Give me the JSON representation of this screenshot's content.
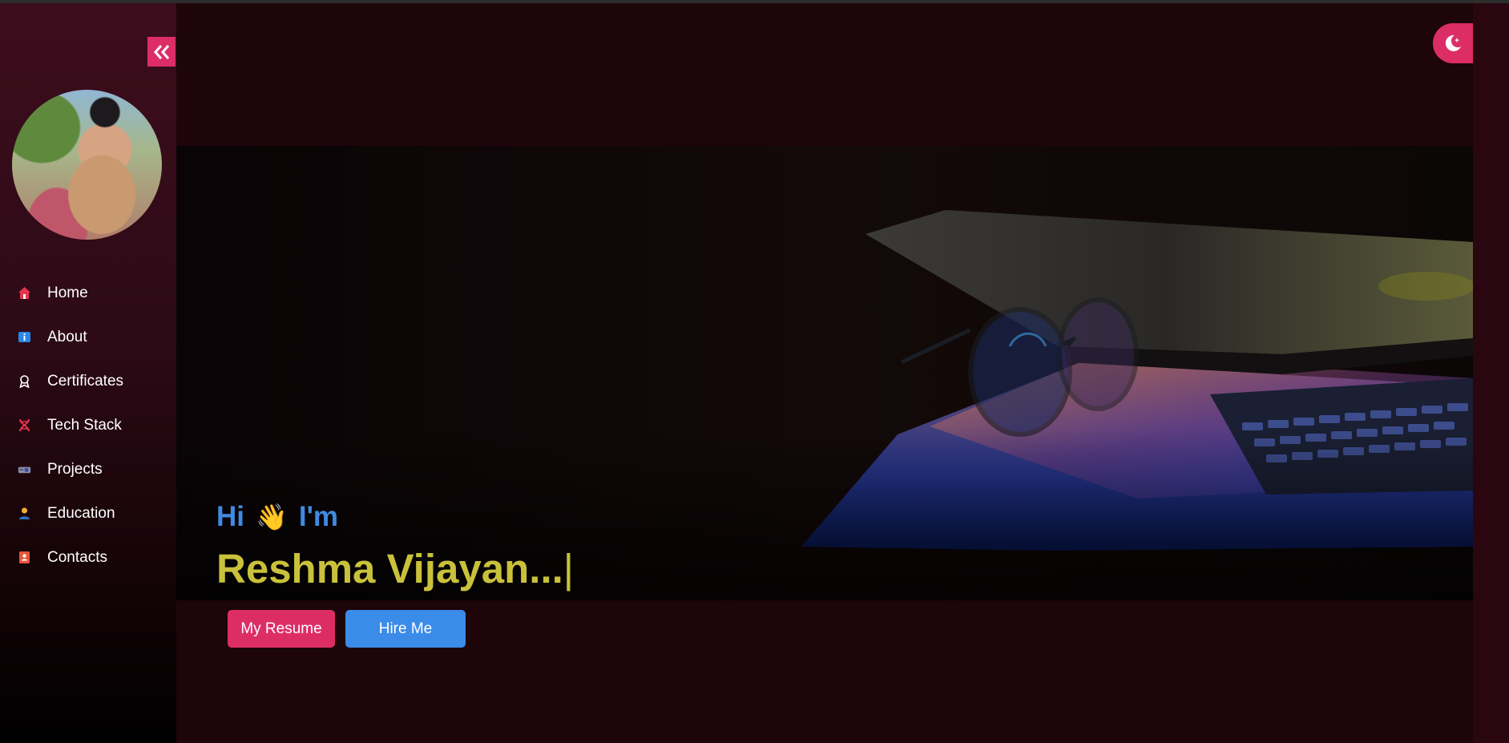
{
  "sidebar": {
    "collapse_icon": "double-chevron-left-icon",
    "avatar_alt": "profile-photo",
    "items": [
      {
        "label": "Home",
        "icon": "home-icon",
        "color": "#e8334f"
      },
      {
        "label": "About",
        "icon": "info-icon",
        "color": "#2a86e8"
      },
      {
        "label": "Certificates",
        "icon": "award-icon",
        "color": "#ffffff"
      },
      {
        "label": "Tech Stack",
        "icon": "dna-icon",
        "color": "#e8334f"
      },
      {
        "label": "Projects",
        "icon": "projector-icon",
        "color": "#8a8aa8"
      },
      {
        "label": "Education",
        "icon": "student-icon",
        "color": "#f2b233"
      },
      {
        "label": "Contacts",
        "icon": "contact-book-icon",
        "color": "#e8553a"
      }
    ]
  },
  "header": {
    "theme_toggle_icon": "moon-stars-icon"
  },
  "hero": {
    "greeting_hi": "Hi",
    "greeting_wave": "👋",
    "greeting_im": "I'm",
    "name": "Reshma Vijayan...",
    "caret": "|"
  },
  "buttons": {
    "resume": "My Resume",
    "hire": "Hire Me"
  },
  "colors": {
    "accent": "#dd2d67",
    "primary_blue": "#3b8be8",
    "name_yellow": "#c9c13b"
  }
}
